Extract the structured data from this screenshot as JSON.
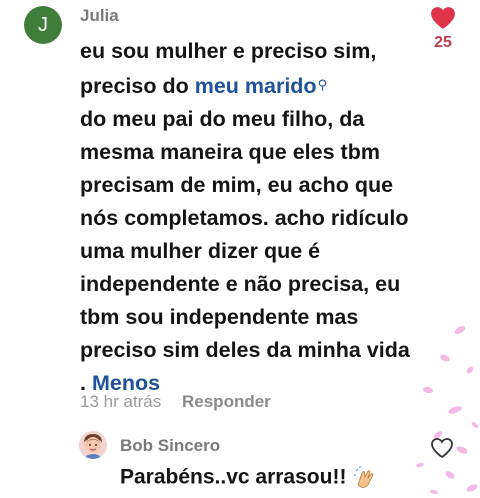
{
  "comment": {
    "avatar_initial": "J",
    "username": "Julia",
    "like_count": "25",
    "text_lines_before_link": "eu sou mulher e preciso sim,\npreciso do ",
    "link_text": "meu marido",
    "text_after_link": "\ndo meu pai do meu filho, da mesma maneira que eles tbm precisam de mim, eu acho que nós completamos. acho ridículo uma mulher dizer que é independente e não precisa, eu tbm sou independente mas preciso sim deles da minha vida .",
    "more_label": "Menos",
    "time": "13 hr atrás",
    "reply_label": "Responder"
  },
  "reply": {
    "username": "Bob Sincero",
    "text": "Parabéns..vc arrasou!!"
  },
  "colors": {
    "accent_blue": "#1f5296",
    "like_red": "#e0344a",
    "avatar_green": "#3f7d3a"
  }
}
